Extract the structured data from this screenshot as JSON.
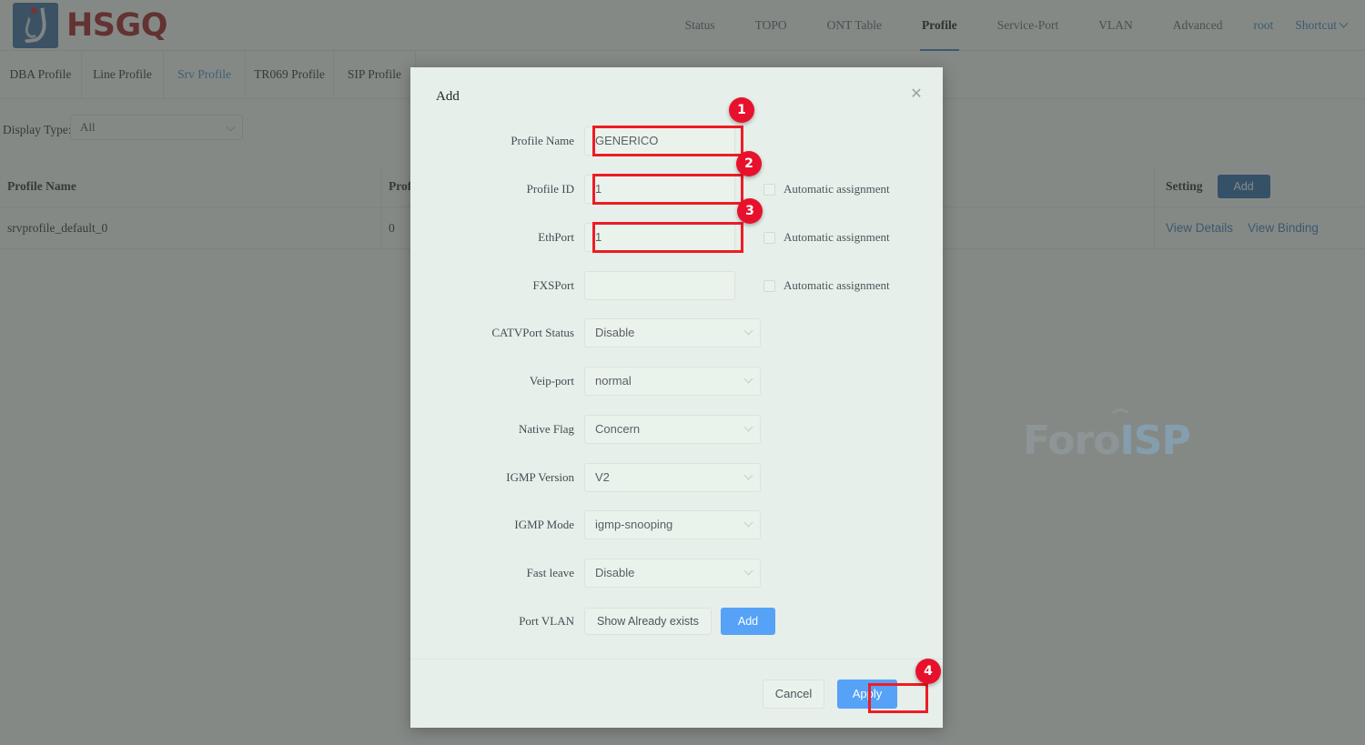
{
  "brand": {
    "name": "HSGQ"
  },
  "nav": {
    "items": [
      {
        "label": "Status",
        "active": false
      },
      {
        "label": "TOPO",
        "active": false
      },
      {
        "label": "ONT Table",
        "active": false
      },
      {
        "label": "Profile",
        "active": true
      },
      {
        "label": "Service-Port",
        "active": false
      },
      {
        "label": "VLAN",
        "active": false
      },
      {
        "label": "Advanced",
        "active": false
      }
    ],
    "user": "root",
    "shortcut": "Shortcut"
  },
  "tabs": [
    {
      "label": "DBA Profile",
      "active": false
    },
    {
      "label": "Line Profile",
      "active": false
    },
    {
      "label": "Srv Profile",
      "active": true
    },
    {
      "label": "TR069 Profile",
      "active": false
    },
    {
      "label": "SIP Profile",
      "active": false
    }
  ],
  "filter": {
    "label": "Display Type:",
    "value": "All"
  },
  "table": {
    "headers": [
      "Profile Name",
      "Prof",
      "Setting"
    ],
    "add_button": "Add",
    "rows": [
      {
        "profile_name": "srvprofile_default_0",
        "profile_id": "0",
        "actions": [
          "View Details",
          "View Binding"
        ]
      }
    ]
  },
  "modal": {
    "title": "Add",
    "close_icon": "close-icon",
    "fields": {
      "profile_name": {
        "label": "Profile Name",
        "value": "GENERICO"
      },
      "profile_id": {
        "label": "Profile ID",
        "value": "1",
        "checkbox": "Automatic assignment"
      },
      "ethport": {
        "label": "EthPort",
        "value": "1",
        "checkbox": "Automatic assignment"
      },
      "fxsport": {
        "label": "FXSPort",
        "value": "",
        "checkbox": "Automatic assignment"
      },
      "catvport": {
        "label": "CATVPort Status",
        "value": "Disable"
      },
      "veip_port": {
        "label": "Veip-port",
        "value": "normal"
      },
      "native_flag": {
        "label": "Native Flag",
        "value": "Concern"
      },
      "igmp_version": {
        "label": "IGMP Version",
        "value": "V2"
      },
      "igmp_mode": {
        "label": "IGMP Mode",
        "value": "igmp-snooping"
      },
      "fast_leave": {
        "label": "Fast leave",
        "value": "Disable"
      },
      "port_vlan": {
        "label": "Port VLAN",
        "show_button": "Show Already exists",
        "add_button": "Add"
      }
    },
    "footer": {
      "cancel": "Cancel",
      "apply": "Apply"
    }
  },
  "watermark": {
    "part_a": "Foro",
    "part_b": "ISP"
  },
  "annotations": {
    "badges": [
      "1",
      "2",
      "3",
      "4"
    ],
    "color": "#e8112d"
  }
}
